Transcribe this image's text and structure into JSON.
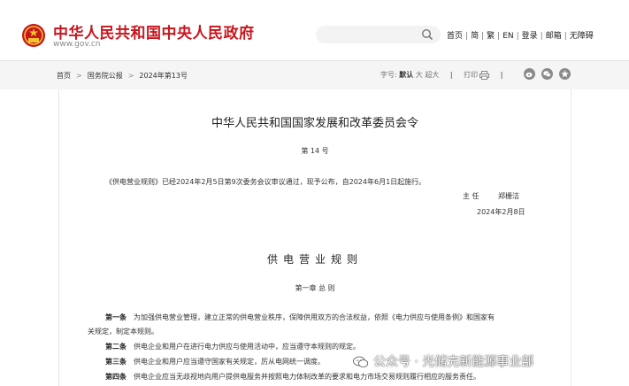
{
  "header": {
    "site_title": "中华人民共和国中央人民政府",
    "site_url": "www.gov.cn",
    "nav": [
      "首页",
      "简",
      "繁",
      "EN",
      "登录",
      "邮箱",
      "无障碍"
    ]
  },
  "toolbar": {
    "breadcrumb": [
      "首页",
      "国务院公报",
      "2024年第13号"
    ],
    "font_label": "字号:",
    "font_default": "默认",
    "font_large": "大",
    "font_xlarge": "超大",
    "print_label": "打印"
  },
  "article": {
    "doc_title": "中华人民共和国国家发展和改革委员会令",
    "order_no": "第  14  号",
    "intro": "《供电营业规则》已经2024年2月5日第9次委务会议审议通过，现予公布，自2024年6月1日起施行。",
    "signer_title": "主  任",
    "signer_name": "郑栅洁",
    "sign_date": "2024年2月8日",
    "rule_title": "供电营业规则",
    "chapter": "第一章  总    则",
    "articles": [
      {
        "label": "第一条",
        "text": "为加强供电营业管理，建立正常的供电营业秩序，保障供用双方的合法权益，依照《电力供应与使用条例》和国家有"
      },
      {
        "label": "",
        "text": "关规定，制定本规则。"
      },
      {
        "label": "第二条",
        "text": "供电企业和用户在进行电力供应与使用活动中，应当遵守本规则的规定。"
      },
      {
        "label": "第三条",
        "text": "供电企业和用户应当遵守国家有关规定，厉从电网统一调度。"
      },
      {
        "label": "第四条",
        "text": "供电企业应当无歧视地向用户提供电服务并按照电力体制改革的要求和电力市场交易规则履行相应的服务责任。"
      }
    ]
  },
  "watermark": {
    "text": "公众号 · 光储充新能源事业部"
  },
  "colors": {
    "brand_red": "#c8161d",
    "toolbar_bg": "#f5f5f5"
  }
}
